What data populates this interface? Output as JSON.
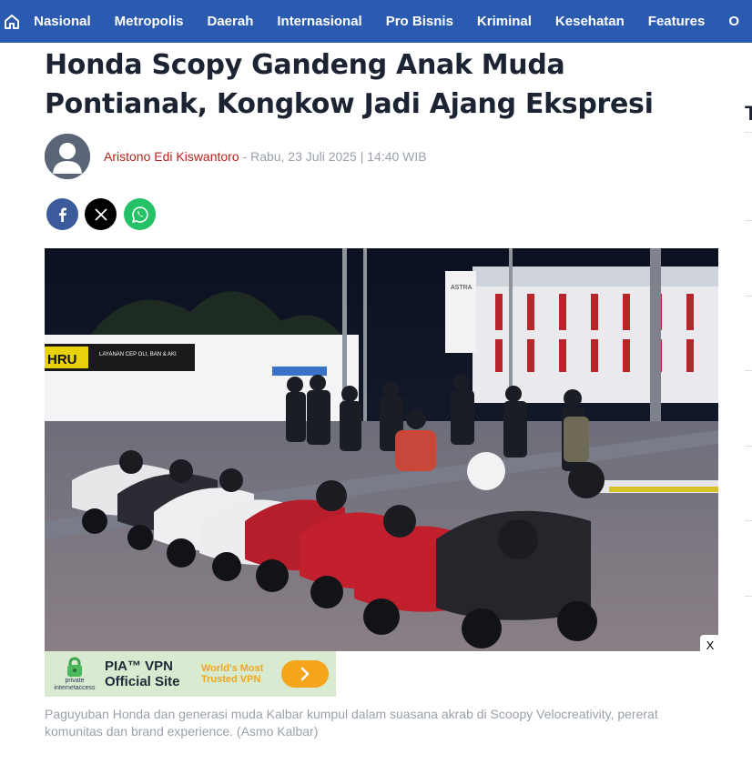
{
  "nav": {
    "items": [
      "Nasional",
      "Metropolis",
      "Daerah",
      "Internasional",
      "Pro Bisnis",
      "Kriminal",
      "Kesehatan",
      "Features",
      "O"
    ]
  },
  "article": {
    "title": "Honda Scopy Gandeng Anak Muda Pontianak, Kongkow Jadi Ajang Ekspresi",
    "author": "Aristono Edi Kiswantoro",
    "dateline": " - Rabu, 23 Juli 2025 | 14:40 WIB",
    "caption": "Paguyuban Honda dan generasi muda Kalbar kumpul dalam suasana akrab di Scoopy Velocreativity, pererat komunitas dan brand experience. (Asmo Kalbar)"
  },
  "share": {
    "icons": [
      "facebook-icon",
      "x-icon",
      "whatsapp-icon"
    ]
  },
  "photo": {
    "sign_text": "HRU",
    "sign_sub": "LAYANAN CEP OLI, BAN & AKI",
    "building_text": "ASTRA"
  },
  "ad": {
    "brand_line1": "private",
    "brand_line2": "internetaccess",
    "headline": "PIA™ VPN Official Site",
    "tagline": "World's Most Trusted VPN",
    "close_label": "X"
  },
  "sidebar": {
    "fragment": "T"
  },
  "colors": {
    "nav": "#2a5bb0",
    "author": "#b3261e",
    "facebook": "#3b5b9c",
    "whatsapp": "#25c166",
    "ad_accent": "#f4a51c"
  }
}
